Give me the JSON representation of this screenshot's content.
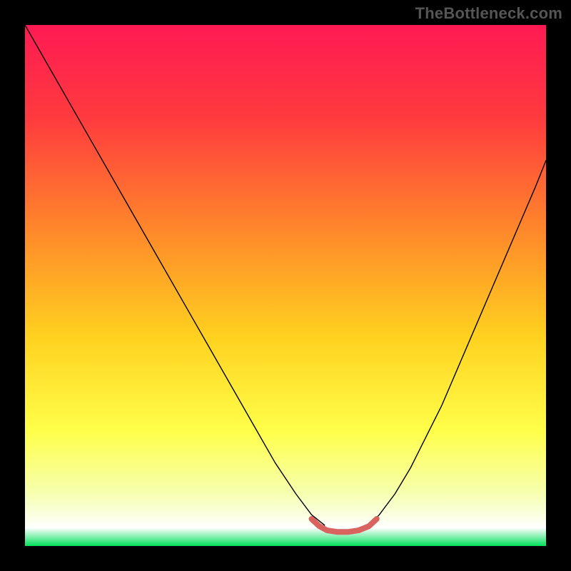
{
  "watermark": "TheBottleneck.com",
  "chart_data": {
    "type": "line",
    "title": "",
    "xlabel": "",
    "ylabel": "",
    "xlim": [
      0,
      100
    ],
    "ylim": [
      0,
      100
    ],
    "background_gradient": {
      "stops": [
        {
          "offset": 0.0,
          "color": "#ff1a53"
        },
        {
          "offset": 0.18,
          "color": "#ff3b3e"
        },
        {
          "offset": 0.4,
          "color": "#ff8a2a"
        },
        {
          "offset": 0.6,
          "color": "#ffd21f"
        },
        {
          "offset": 0.78,
          "color": "#ffff4a"
        },
        {
          "offset": 0.9,
          "color": "#f6ffb0"
        },
        {
          "offset": 0.965,
          "color": "#ffffff"
        },
        {
          "offset": 1.0,
          "color": "#00e05a"
        }
      ]
    },
    "series": [
      {
        "name": "left-curve",
        "color": "#000000",
        "width": 1.4,
        "x": [
          0,
          4,
          8,
          12,
          16,
          20,
          24,
          28,
          32,
          36,
          40,
          44,
          48,
          52,
          55,
          57.5
        ],
        "y": [
          100,
          93,
          86,
          79,
          72,
          65,
          58,
          51,
          44,
          37,
          30,
          23,
          16,
          10,
          6,
          4
        ]
      },
      {
        "name": "right-curve",
        "color": "#000000",
        "width": 1.4,
        "x": [
          66,
          68,
          71,
          74,
          77,
          80,
          83,
          86,
          89,
          92,
          95,
          98,
          100
        ],
        "y": [
          4,
          6,
          10,
          15,
          21,
          27,
          34,
          41,
          48,
          55,
          62,
          69,
          74
        ]
      },
      {
        "name": "bottleneck-zone",
        "color": "#d9645f",
        "width": 8,
        "x": [
          55,
          56.5,
          58,
          60,
          62,
          64,
          66,
          67.5
        ],
        "y": [
          5.2,
          3.8,
          3.0,
          2.7,
          2.7,
          3.0,
          3.8,
          5.2
        ]
      }
    ]
  }
}
